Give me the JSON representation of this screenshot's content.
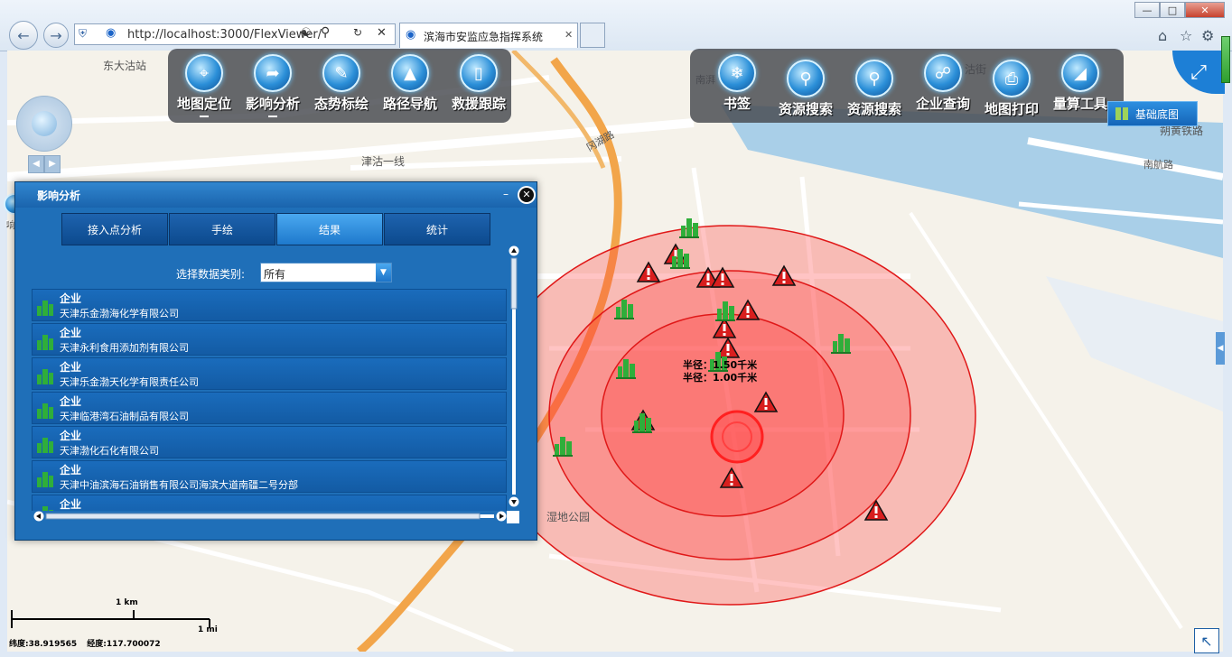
{
  "browser": {
    "url": "http://localhost:3000/FlexViewer/",
    "tab_title": "滨海市安监应急指挥系统",
    "back_icon": "back-arrow-icon",
    "forward_icon": "forward-arrow-icon"
  },
  "map_labels": {
    "dongdagu": "东大沽站",
    "jingu_line": "津沽一线",
    "road_top_right": "沽街",
    "shuohuang": "朔黄铁路",
    "nanhang": "南航路",
    "wetland_park": "湿地公园",
    "road_curve": "冈湖路",
    "road_topright2": "南湃",
    "radius_label_1": "半径：1.50千米",
    "radius_label_2": "半径：1.00千米"
  },
  "toolbar_left": [
    {
      "label": "地图定位",
      "icon": "locate-icon"
    },
    {
      "label": "影响分析",
      "icon": "impact-analysis-icon"
    },
    {
      "label": "态势标绘",
      "icon": "plotting-icon"
    },
    {
      "label": "路径导航",
      "icon": "navigation-icon"
    },
    {
      "label": "救援跟踪",
      "icon": "rescue-tracking-icon"
    }
  ],
  "toolbar_right": [
    {
      "label": "书签",
      "icon": "bookmark-icon"
    },
    {
      "label": "资源搜索",
      "icon": "resource-search-icon"
    },
    {
      "label": "资源搜索",
      "icon": "resource-search-icon"
    },
    {
      "label": "企业查询",
      "icon": "enterprise-query-icon"
    },
    {
      "label": "地图打印",
      "icon": "print-icon"
    },
    {
      "label": "量算工具",
      "icon": "measure-icon"
    }
  ],
  "basemap_button": "基础底图",
  "side_tab_label": "响分析",
  "panel": {
    "title": "影响分析",
    "tabs": [
      "接入点分析",
      "手绘",
      "结果",
      "统计"
    ],
    "active_tab": 2,
    "filter_label": "选择数据类别:",
    "filter_value": "所有",
    "results": [
      {
        "type": "企业",
        "name": "天津乐金渤海化学有限公司"
      },
      {
        "type": "企业",
        "name": "天津永利食用添加剂有限公司"
      },
      {
        "type": "企业",
        "name": "天津乐金渤天化学有限责任公司"
      },
      {
        "type": "企业",
        "name": "天津临港湾石油制品有限公司"
      },
      {
        "type": "企业",
        "name": "天津渤化石化有限公司"
      },
      {
        "type": "企业",
        "name": "天津中油滨海石油销售有限公司海滨大道南疆二号分部"
      },
      {
        "type": "企业",
        "name": ""
      }
    ]
  },
  "scale": {
    "km": "1 km",
    "mi": "1 mi"
  },
  "status": {
    "lat": "纬度:38.919565",
    "lon": "经度:117.700072"
  },
  "colors": {
    "panel": "#1f6fb8",
    "buffer_fill": "#ff3b3b",
    "toolbar": "#46484e"
  }
}
